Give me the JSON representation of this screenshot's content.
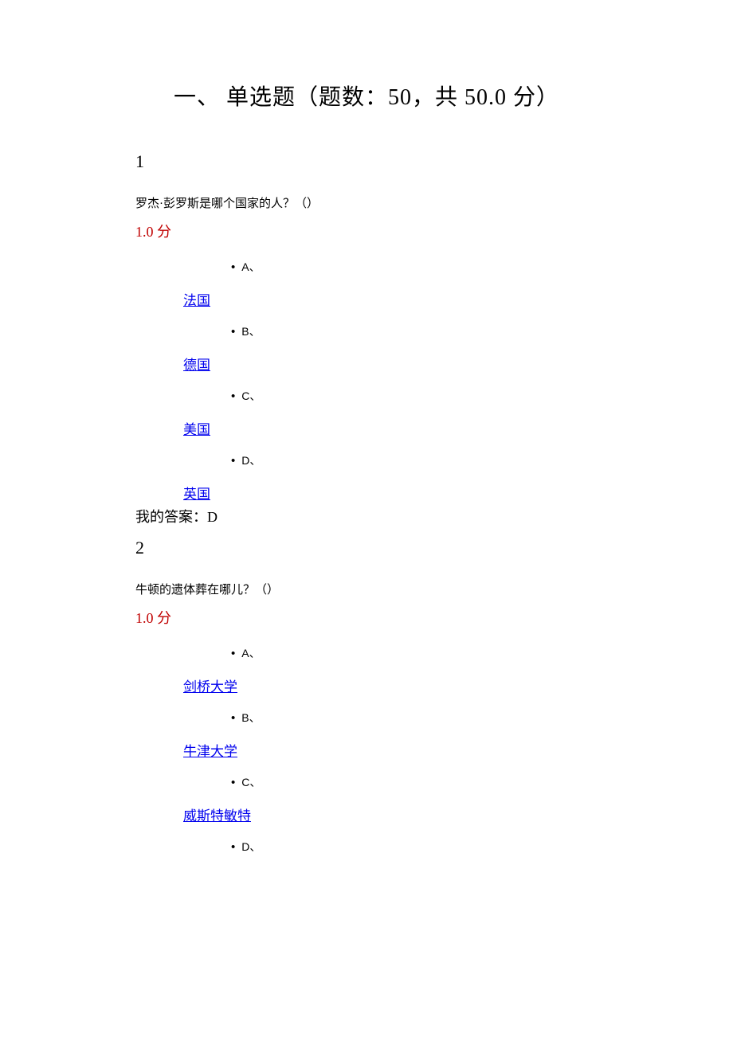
{
  "section": {
    "title": "一、 单选题（题数：50，共  50.0  分）"
  },
  "questions": [
    {
      "number": "1",
      "text": "罗杰·彭罗斯是哪个国家的人？（）",
      "score": "1.0  分",
      "options": [
        {
          "letter": "A、",
          "label": "法国"
        },
        {
          "letter": "B、",
          "label": "德国"
        },
        {
          "letter": "C、",
          "label": "美国"
        },
        {
          "letter": "D、",
          "label": "英国"
        }
      ],
      "myAnswer": "我的答案：D"
    },
    {
      "number": "2",
      "text": "牛顿的遗体葬在哪儿？（）",
      "score": "1.0  分",
      "options": [
        {
          "letter": "A、",
          "label": "剑桥大学"
        },
        {
          "letter": "B、",
          "label": "牛津大学"
        },
        {
          "letter": "C、",
          "label": "威斯特敏特"
        },
        {
          "letter": "D、",
          "label": ""
        }
      ],
      "myAnswer": ""
    }
  ]
}
